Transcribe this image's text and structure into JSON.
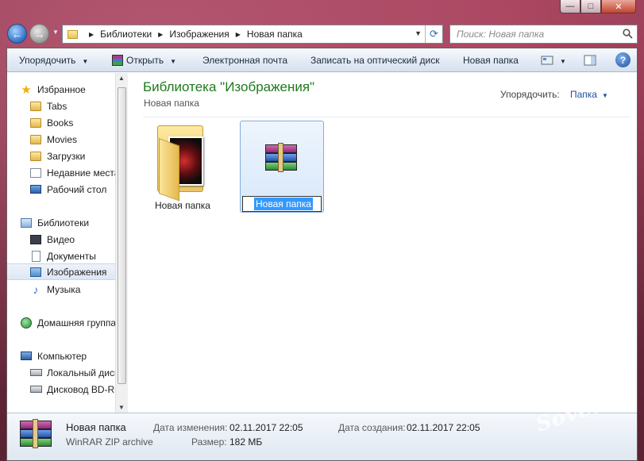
{
  "window": {
    "minimize": "—",
    "maximize": "□",
    "close": "✕"
  },
  "address": {
    "crumbs": [
      "Библиотеки",
      "Изображения",
      "Новая папка"
    ],
    "search_placeholder": "Поиск: Новая папка"
  },
  "toolbar": {
    "organize": "Упорядочить",
    "open": "Открыть",
    "email": "Электронная почта",
    "burn": "Записать на оптический диск",
    "new_folder": "Новая папка",
    "help": "?"
  },
  "nav": {
    "favorites": "Избранное",
    "fav_items": [
      "Tabs",
      "Books",
      "Movies",
      "Загрузки",
      "Недавние места",
      "Рабочий стол"
    ],
    "libraries": "Библиотеки",
    "lib_items": [
      "Видео",
      "Документы",
      "Изображения",
      "Музыка"
    ],
    "homegroup": "Домашняя группа",
    "computer": "Компьютер",
    "computer_items": [
      "Локальный диск (C:)",
      "Дисковод BD-ROM"
    ]
  },
  "content": {
    "title": "Библиотека \"Изображения\"",
    "subtitle": "Новая папка",
    "arrange_label": "Упорядочить:",
    "arrange_value": "Папка",
    "items": [
      {
        "name": "Новая папка",
        "kind": "folder"
      },
      {
        "name": "Новая папка",
        "kind": "winrar-archive",
        "state": "renaming"
      }
    ]
  },
  "details": {
    "name": "Новая папка",
    "type": "WinRAR ZIP archive",
    "modified_label": "Дата изменения:",
    "modified": "02.11.2017 22:05",
    "size_label": "Размер:",
    "size": "182 МБ",
    "created_label": "Дата создания:",
    "created": "02.11.2017 22:05"
  },
  "watermark": "club Sovet",
  "colors": {
    "title_green": "#1e7a1e",
    "selection": "#3399ff",
    "link_blue": "#1e4f9c"
  }
}
